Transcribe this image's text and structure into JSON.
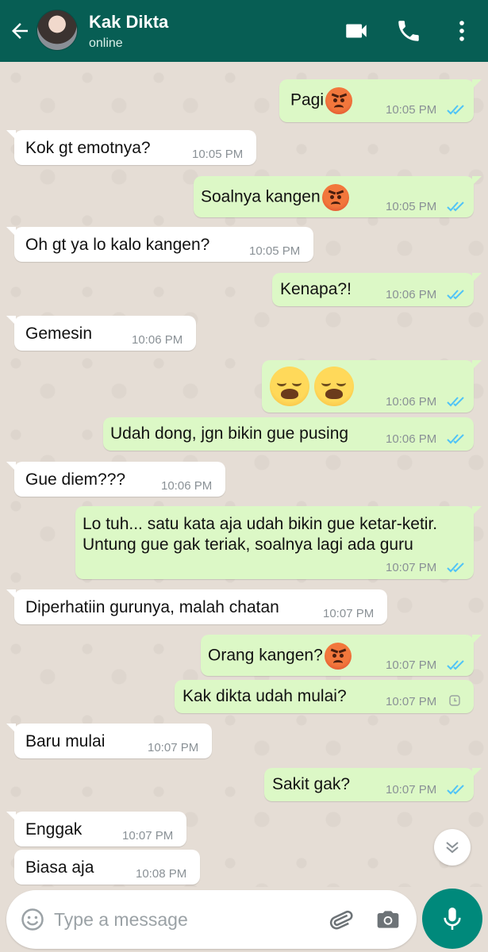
{
  "header": {
    "contact_name": "Kak Dikta",
    "status": "online",
    "back_icon": "arrow-left-icon",
    "video_icon": "video-call-icon",
    "call_icon": "phone-icon",
    "menu_icon": "more-vert-icon"
  },
  "messages": [
    {
      "dir": "out",
      "text": "Pagi",
      "emoji": "pouting-face",
      "time": "10:05 PM",
      "status": "read"
    },
    {
      "dir": "in",
      "text": "Kok gt emotnya?",
      "time": "10:05 PM"
    },
    {
      "dir": "out",
      "text": "Soalnya kangen",
      "emoji": "pouting-face",
      "time": "10:05 PM",
      "status": "read"
    },
    {
      "dir": "in",
      "text": "Oh gt ya lo kalo kangen?",
      "time": "10:05 PM"
    },
    {
      "dir": "out",
      "text": "Kenapa?!",
      "time": "10:06 PM",
      "status": "read"
    },
    {
      "dir": "in",
      "text": "Gemesin",
      "time": "10:06 PM"
    },
    {
      "dir": "out",
      "text": "",
      "emoji": "weary-face x2",
      "time": "10:06 PM",
      "status": "read"
    },
    {
      "dir": "out",
      "text": "Udah dong, jgn bikin gue pusing",
      "time": "10:06 PM",
      "status": "read"
    },
    {
      "dir": "in",
      "text": "Gue diem???",
      "time": "10:06 PM"
    },
    {
      "dir": "out",
      "text_line1": "Lo tuh... satu kata aja udah bikin gue ketar-ketir.",
      "text_line2": "Untung gue gak teriak, soalnya lagi ada guru",
      "time": "10:07 PM",
      "status": "read"
    },
    {
      "dir": "in",
      "text": "Diperhatiin gurunya, malah chatan",
      "time": "10:07 PM"
    },
    {
      "dir": "out",
      "text": "Orang kangen?",
      "emoji": "pouting-face",
      "time": "10:07 PM",
      "status": "read"
    },
    {
      "dir": "out",
      "text": "Kak dikta udah mulai?",
      "time": "10:07 PM",
      "status": "pending"
    },
    {
      "dir": "in",
      "text": "Baru mulai",
      "time": "10:07 PM"
    },
    {
      "dir": "out",
      "text": "Sakit gak?",
      "time": "10:07 PM",
      "status": "read"
    },
    {
      "dir": "in",
      "text": "Enggak",
      "time": "10:07 PM"
    },
    {
      "dir": "in",
      "text": "Biasa aja",
      "time": "10:08 PM"
    }
  ],
  "input": {
    "placeholder": "Type a message",
    "emoji_icon": "smiley-icon",
    "attach_icon": "paperclip-icon",
    "camera_icon": "camera-icon",
    "mic_icon": "microphone-icon"
  },
  "scroll_icon": "chevron-double-down-icon",
  "colors": {
    "header": "#075e54",
    "outgoing": "#dcf8c6",
    "incoming": "#ffffff",
    "read_ticks": "#4fc3f7",
    "mic_button": "#00897b",
    "chat_bg": "#e5ddd5"
  }
}
